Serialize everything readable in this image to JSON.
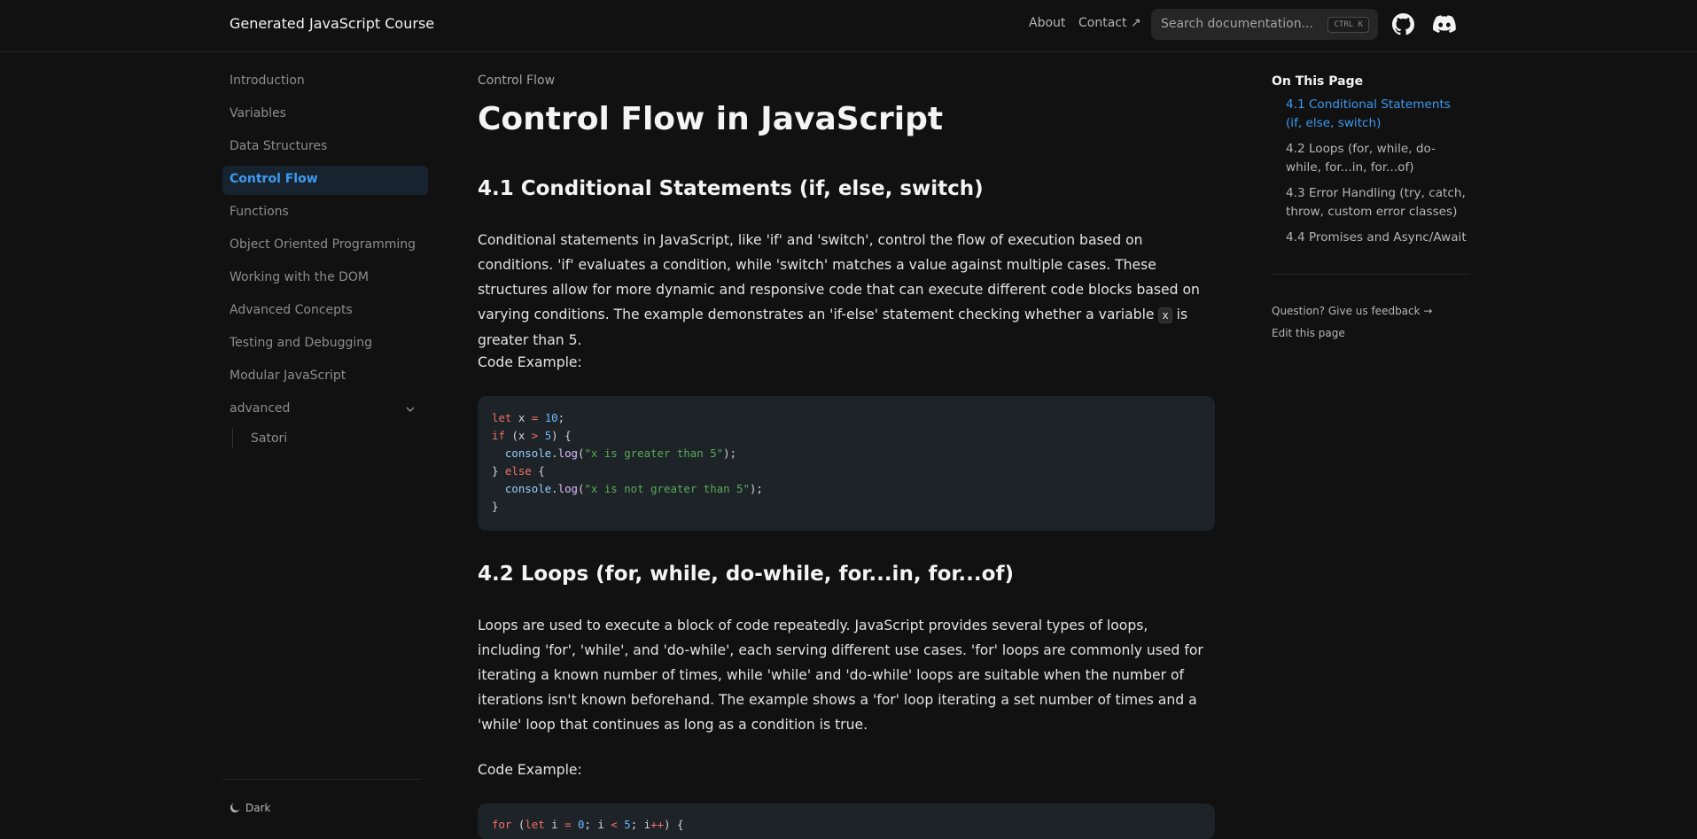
{
  "header": {
    "logo": "Generated JavaScript Course",
    "nav": [
      {
        "label": "About"
      },
      {
        "label": "Contact ↗"
      }
    ],
    "search": {
      "placeholder": "Search documentation...",
      "shortcut": "CTRL K"
    },
    "icons": [
      "github-icon",
      "discord-icon"
    ]
  },
  "sidebar": {
    "items": [
      {
        "label": "Introduction"
      },
      {
        "label": "Variables"
      },
      {
        "label": "Data Structures"
      },
      {
        "label": "Control Flow",
        "active": true
      },
      {
        "label": "Functions"
      },
      {
        "label": "Object Oriented Programming"
      },
      {
        "label": "Working with the DOM"
      },
      {
        "label": "Advanced Concepts"
      },
      {
        "label": "Testing and Debugging"
      },
      {
        "label": "Modular JavaScript"
      },
      {
        "label": "advanced",
        "expanded": true
      }
    ],
    "sub_items": [
      {
        "label": "Satori"
      }
    ],
    "theme_label": "Dark"
  },
  "main": {
    "breadcrumb": "Control Flow",
    "title": "Control Flow in JavaScript",
    "sections": [
      {
        "heading": "4.1 Conditional Statements (if, else, switch)",
        "paragraph_before": "Conditional statements in JavaScript, like 'if' and 'switch', control the flow of execution based on conditions. 'if' evaluates a condition, while 'switch' matches a value against multiple cases. These structures allow for more dynamic and responsive code that can execute different code blocks based on varying conditions. The example demonstrates an 'if-else' statement checking whether a variable ",
        "inline_code": "x",
        "paragraph_after": " is greater than 5.",
        "code_label": "Code Example:",
        "code": [
          "let x = 10;",
          "if (x > 5) {",
          "  console.log(\"x is greater than 5\");",
          "} else {",
          "  console.log(\"x is not greater than 5\");",
          "}"
        ]
      },
      {
        "heading": "4.2 Loops (for, while, do-while, for...in, for...of)",
        "paragraph": "Loops are used to execute a block of code repeatedly. JavaScript provides several types of loops, including 'for', 'while', and 'do-while', each serving different use cases. 'for' loops are commonly used for iterating a known number of times, while 'while' and 'do-while' loops are suitable when the number of iterations isn't known beforehand. The example shows a 'for' loop iterating a set number of times and a 'while' loop that continues as long as a condition is true.",
        "code_label": "Code Example:",
        "code_first_line": "for (let i = 0; i < 5; i++) {"
      }
    ]
  },
  "toc": {
    "title": "On This Page",
    "items": [
      {
        "label": "4.1 Conditional Statements (if, else, switch)",
        "active": true
      },
      {
        "label": "4.2 Loops (for, while, do-while, for...in, for...of)"
      },
      {
        "label": "4.3 Error Handling (try, catch, throw, custom error classes)"
      },
      {
        "label": "4.4 Promises and Async/Await"
      }
    ],
    "feedback": "Question? Give us feedback →",
    "edit": "Edit this page"
  },
  "colors": {
    "background": "#111111",
    "accent": "#3b9bf0",
    "code_background": "#1e2328"
  }
}
